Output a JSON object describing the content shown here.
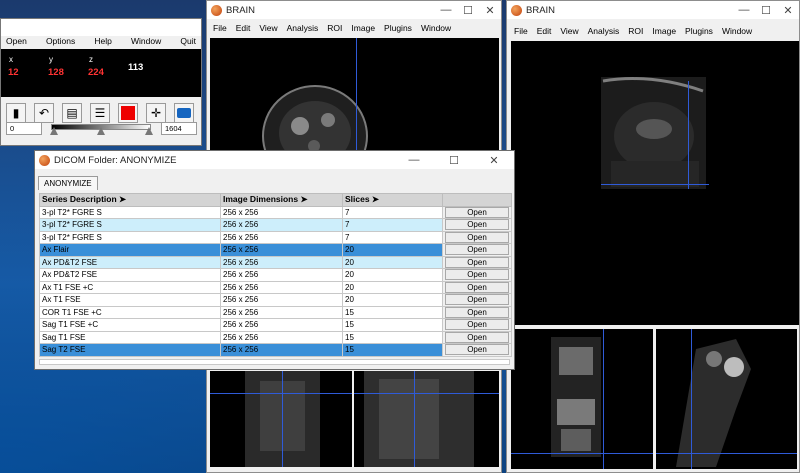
{
  "image_viewer_left": {
    "title": "BRAIN",
    "menu": [
      "File",
      "Edit",
      "View",
      "Analysis",
      "ROI",
      "Image",
      "Plugins",
      "Window"
    ],
    "controls": [
      "—",
      "☐",
      "✕"
    ]
  },
  "image_viewer_right": {
    "title": "BRAIN",
    "menu": [
      "File",
      "Edit",
      "View",
      "Analysis",
      "ROI",
      "Image",
      "Plugins",
      "Window"
    ],
    "controls": [
      "—",
      "☐",
      "✕"
    ]
  },
  "control_panel": {
    "menu": [
      "Open",
      "Options",
      "Help",
      "Window",
      "Quit"
    ],
    "x_label": "x",
    "y_label": "y",
    "z_label": "z",
    "x_value": "12",
    "y_value": "128",
    "z_value": "224",
    "intensity_value": "113",
    "min_value": "0",
    "max_value": "1604",
    "tools": [
      {
        "name": "grayscale-tool-icon",
        "glyph": "▮"
      },
      {
        "name": "undo-tool-icon",
        "glyph": "↶"
      },
      {
        "name": "film-tool-icon",
        "glyph": "▤"
      },
      {
        "name": "layers-tool-icon",
        "glyph": "☰"
      },
      {
        "name": "red-color-tool-icon",
        "glyph": ""
      },
      {
        "name": "crosshair-tool-icon",
        "glyph": "✛"
      },
      {
        "name": "camera-tool-icon",
        "glyph": "📷"
      }
    ]
  },
  "dicom_dialog": {
    "title": "DICOM Folder: ANONYMIZE",
    "controls": [
      "—",
      "☐",
      "✕"
    ],
    "tab": "ANONYMIZE",
    "columns": [
      "Series Description ➤",
      "Image Dimensions ➤",
      "Slices ➤",
      ""
    ],
    "open_label": "Open",
    "rows": [
      {
        "desc": "3-pl T2* FGRE S",
        "dims": "256 x 256",
        "slices": "7",
        "state": "normal"
      },
      {
        "desc": "3-pl T2* FGRE S",
        "dims": "256 x 256",
        "slices": "7",
        "state": "light"
      },
      {
        "desc": "3-pl T2* FGRE S",
        "dims": "256 x 256",
        "slices": "7",
        "state": "normal"
      },
      {
        "desc": "Ax Flair",
        "dims": "256 x 256",
        "slices": "20",
        "state": "selected"
      },
      {
        "desc": "Ax PD&T2 FSE",
        "dims": "256 x 256",
        "slices": "20",
        "state": "light"
      },
      {
        "desc": "Ax PD&T2 FSE",
        "dims": "256 x 256",
        "slices": "20",
        "state": "normal"
      },
      {
        "desc": "Ax T1 FSE +C",
        "dims": "256 x 256",
        "slices": "20",
        "state": "normal"
      },
      {
        "desc": "Ax T1 FSE",
        "dims": "256 x 256",
        "slices": "20",
        "state": "normal"
      },
      {
        "desc": "COR T1 FSE +C",
        "dims": "256 x 256",
        "slices": "15",
        "state": "normal"
      },
      {
        "desc": "Sag T1 FSE +C",
        "dims": "256 x 256",
        "slices": "15",
        "state": "normal"
      },
      {
        "desc": "Sag T1 FSE",
        "dims": "256 x 256",
        "slices": "15",
        "state": "normal"
      },
      {
        "desc": "Sag T2 FSE",
        "dims": "256 x 256",
        "slices": "15",
        "state": "selected"
      }
    ]
  },
  "colors": {
    "crosshair": "#2f5bd8",
    "selected_row": "#3a8fd8",
    "highlight_row": "#cdeefb",
    "coordinate_text": "#ff3333"
  }
}
